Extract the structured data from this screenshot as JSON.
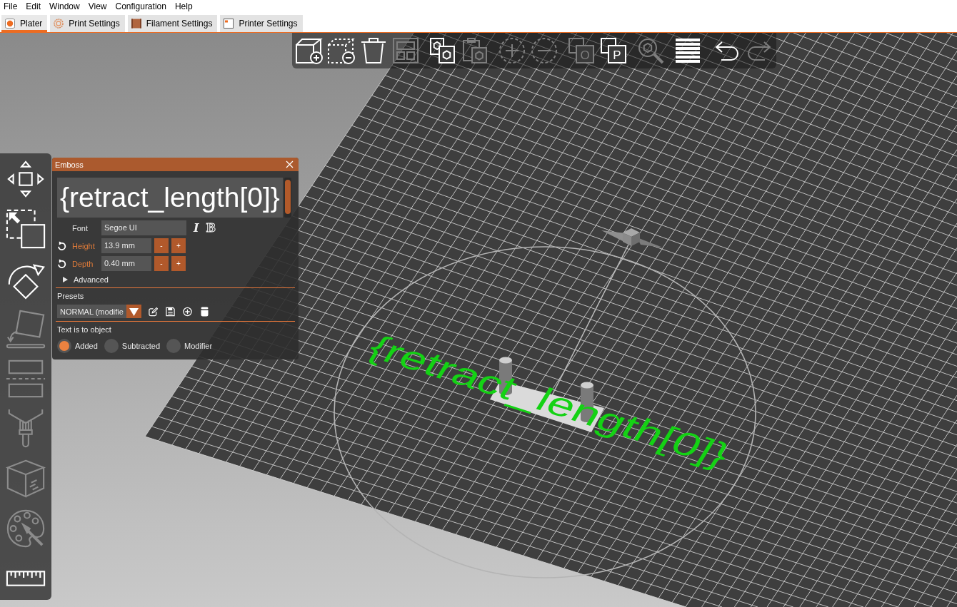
{
  "menu": [
    "File",
    "Edit",
    "Window",
    "View",
    "Configuration",
    "Help"
  ],
  "tabs": [
    {
      "label": "Plater",
      "selected": true
    },
    {
      "label": "Print Settings",
      "selected": false
    },
    {
      "label": "Filament Settings",
      "selected": false
    },
    {
      "label": "Printer Settings",
      "selected": false
    }
  ],
  "top_toolbar": [
    {
      "disabled": false
    },
    {
      "disabled": false
    },
    {
      "disabled": false
    },
    {
      "disabled": true
    },
    {
      "disabled": false
    },
    {
      "disabled": true
    },
    {
      "disabled": true
    },
    {
      "disabled": true
    },
    {
      "disabled": true,
      "glyph": "O"
    },
    {
      "disabled": false,
      "glyph": "P"
    },
    {
      "disabled": true
    },
    {
      "disabled": false
    },
    {
      "disabled": false
    },
    {
      "disabled": true
    }
  ],
  "left_toolbar": [
    {
      "disabled": false
    },
    {
      "disabled": false
    },
    {
      "disabled": false
    },
    {
      "disabled": true
    },
    {
      "disabled": true
    },
    {
      "disabled": true
    },
    {
      "disabled": true
    },
    {
      "disabled": true
    },
    {
      "disabled": false
    }
  ],
  "emboss": {
    "title": "Emboss",
    "text": "{retract_length[0]}",
    "fields": [
      {
        "kind": "font",
        "label": "Font",
        "value": "Segoe UI",
        "modified": false,
        "toggles": [
          "I",
          "B"
        ]
      },
      {
        "kind": "number",
        "label": "Height",
        "value": "13.9 mm",
        "modified": true,
        "decrement": "-",
        "increment": "+"
      },
      {
        "kind": "number",
        "label": "Depth",
        "value": "0.40 mm",
        "modified": true,
        "decrement": "-",
        "increment": "+"
      }
    ],
    "advanced": {
      "label": "Advanced",
      "expanded": false
    },
    "presets": {
      "label": "Presets",
      "value": "NORMAL (modifie"
    },
    "operation": {
      "label": "Text is to object",
      "options": [
        {
          "label": "Added",
          "selected": true
        },
        {
          "label": "Subtracted",
          "selected": false
        },
        {
          "label": "Modifier",
          "selected": false
        }
      ]
    }
  },
  "scene": {
    "model_text": "{retract_length[0]}"
  }
}
